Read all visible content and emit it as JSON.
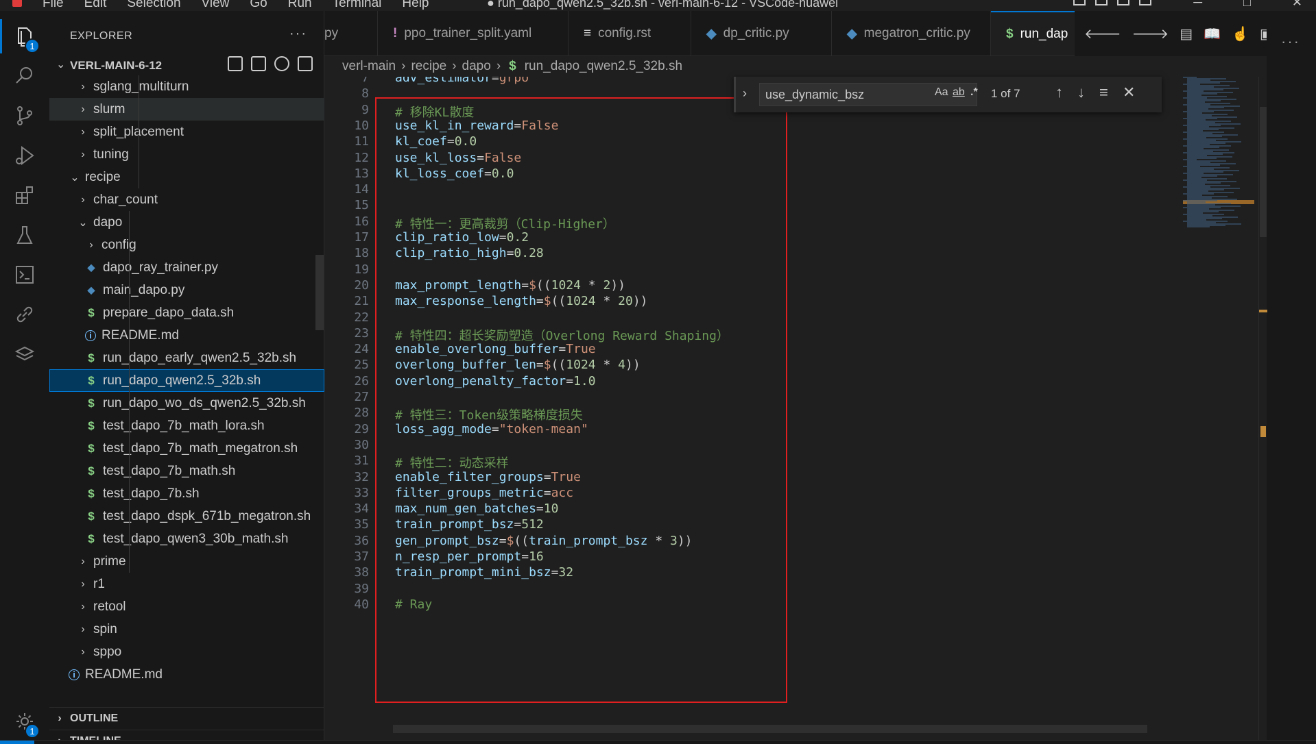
{
  "titlebar": {
    "menu": [
      "File",
      "Edit",
      "Selection",
      "View",
      "Go",
      "Run",
      "Terminal",
      "Help"
    ],
    "title": "● run_dapo_qwen2.5_32b.sh - verl-main-6-12 - VSCode-huawei"
  },
  "activity": {
    "explorer_badge": "1",
    "settings_badge": "1"
  },
  "sidebar": {
    "header": "EXPLORER",
    "more": "···",
    "root": "VERL-MAIN-6-12",
    "tree": [
      {
        "label": "sglang_multiturn",
        "type": "folder",
        "open": false
      },
      {
        "label": "slurm",
        "type": "folder",
        "open": false
      },
      {
        "label": "split_placement",
        "type": "folder",
        "open": false
      },
      {
        "label": "tuning",
        "type": "folder",
        "open": false
      },
      {
        "label": "recipe",
        "type": "folder",
        "open": true
      },
      {
        "label": "char_count",
        "type": "folder",
        "open": false
      },
      {
        "label": "dapo",
        "type": "folder",
        "open": true
      },
      {
        "label": "config",
        "type": "folder",
        "open": false
      },
      {
        "label": "dapo_ray_trainer.py",
        "type": "py"
      },
      {
        "label": "main_dapo.py",
        "type": "py"
      },
      {
        "label": "prepare_dapo_data.sh",
        "type": "sh"
      },
      {
        "label": "README.md",
        "type": "md"
      },
      {
        "label": "run_dapo_early_qwen2.5_32b.sh",
        "type": "sh"
      },
      {
        "label": "run_dapo_qwen2.5_32b.sh",
        "type": "sh"
      },
      {
        "label": "run_dapo_wo_ds_qwen2.5_32b.sh",
        "type": "sh"
      },
      {
        "label": "test_dapo_7b_math_lora.sh",
        "type": "sh"
      },
      {
        "label": "test_dapo_7b_math_megatron.sh",
        "type": "sh"
      },
      {
        "label": "test_dapo_7b_math.sh",
        "type": "sh"
      },
      {
        "label": "test_dapo_7b.sh",
        "type": "sh"
      },
      {
        "label": "test_dapo_dspk_671b_megatron.sh",
        "type": "sh"
      },
      {
        "label": "test_dapo_qwen3_30b_math.sh",
        "type": "sh"
      },
      {
        "label": "prime",
        "type": "folder",
        "open": false
      },
      {
        "label": "r1",
        "type": "folder",
        "open": false
      },
      {
        "label": "retool",
        "type": "folder",
        "open": false
      },
      {
        "label": "spin",
        "type": "folder",
        "open": false
      },
      {
        "label": "sppo",
        "type": "folder",
        "open": false
      },
      {
        "label": "README.md",
        "type": "md"
      }
    ],
    "outline": "OUTLINE",
    "timeline": "TIMELINE"
  },
  "tabs": [
    {
      "label": "py",
      "icon": ""
    },
    {
      "label": "ppo_trainer_split.yaml",
      "icon": "!"
    },
    {
      "label": "config.rst",
      "icon": "≡"
    },
    {
      "label": "dp_critic.py",
      "icon": "py"
    },
    {
      "label": "megatron_critic.py",
      "icon": "py"
    },
    {
      "label": "run_dap",
      "icon": "$"
    }
  ],
  "breadcrumb": [
    "verl-main",
    "recipe",
    "dapo",
    "run_dapo_qwen2.5_32b.sh"
  ],
  "find": {
    "query": "use_dynamic_bsz",
    "opt_case": "Aa",
    "opt_word": "ab",
    "opt_regex": ".*",
    "count": "1 of 7"
  },
  "code_lines": [
    {
      "n": "7",
      "text": "adv_estimator=grpo"
    },
    {
      "n": "8",
      "text": ""
    },
    {
      "n": "9",
      "text": "# 移除KL散度"
    },
    {
      "n": "10",
      "text": "use_kl_in_reward=False"
    },
    {
      "n": "11",
      "text": "kl_coef=0.0"
    },
    {
      "n": "12",
      "text": "use_kl_loss=False"
    },
    {
      "n": "13",
      "text": "kl_loss_coef=0.0"
    },
    {
      "n": "14",
      "text": ""
    },
    {
      "n": "15",
      "text": ""
    },
    {
      "n": "16",
      "text": "# 特性一：更高裁剪（Clip-Higher）"
    },
    {
      "n": "17",
      "text": "clip_ratio_low=0.2"
    },
    {
      "n": "18",
      "text": "clip_ratio_high=0.28"
    },
    {
      "n": "19",
      "text": ""
    },
    {
      "n": "20",
      "text": "max_prompt_length=$((1024 * 2))"
    },
    {
      "n": "21",
      "text": "max_response_length=$((1024 * 20))"
    },
    {
      "n": "22",
      "text": ""
    },
    {
      "n": "23",
      "text": "# 特性四：超长奖励塑造（Overlong Reward Shaping）"
    },
    {
      "n": "24",
      "text": "enable_overlong_buffer=True"
    },
    {
      "n": "25",
      "text": "overlong_buffer_len=$((1024 * 4))"
    },
    {
      "n": "26",
      "text": "overlong_penalty_factor=1.0"
    },
    {
      "n": "27",
      "text": ""
    },
    {
      "n": "28",
      "text": "# 特性三：Token级策略梯度损失"
    },
    {
      "n": "29",
      "text": "loss_agg_mode=\"token-mean\""
    },
    {
      "n": "30",
      "text": ""
    },
    {
      "n": "31",
      "text": "# 特性二：动态采样"
    },
    {
      "n": "32",
      "text": "enable_filter_groups=True"
    },
    {
      "n": "33",
      "text": "filter_groups_metric=acc"
    },
    {
      "n": "34",
      "text": "max_num_gen_batches=10"
    },
    {
      "n": "35",
      "text": "train_prompt_bsz=512"
    },
    {
      "n": "36",
      "text": "gen_prompt_bsz=$((train_prompt_bsz * 3))"
    },
    {
      "n": "37",
      "text": "n_resp_per_prompt=16"
    },
    {
      "n": "38",
      "text": "train_prompt_mini_bsz=32"
    },
    {
      "n": "39",
      "text": ""
    },
    {
      "n": "40",
      "text": "# Ray"
    }
  ],
  "colors": {
    "accent": "#0078d4",
    "highlight_box": "#e02020"
  }
}
